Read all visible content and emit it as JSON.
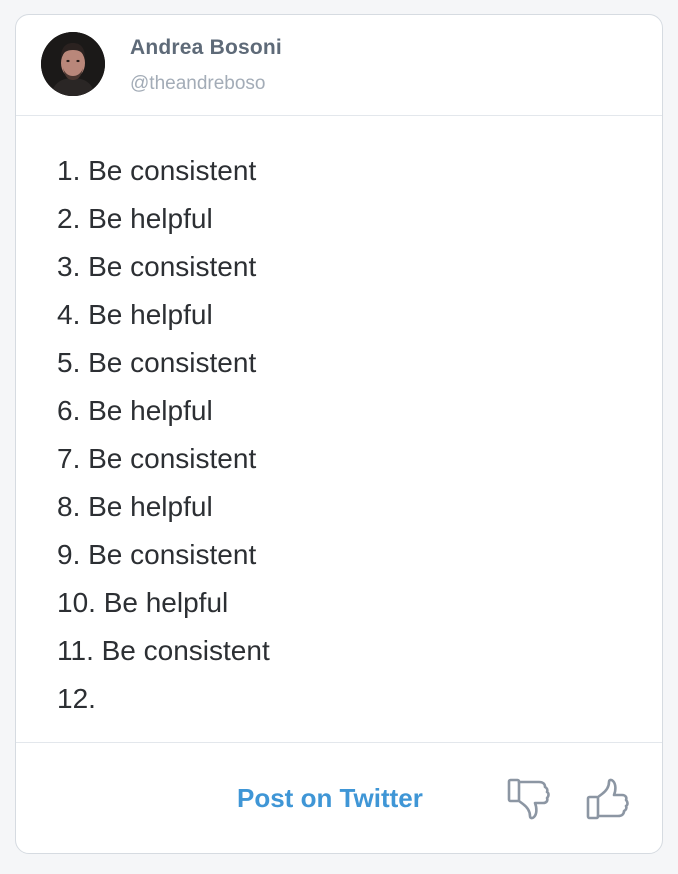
{
  "author": {
    "name": "Andrea Bosoni",
    "handle": "@theandreboso"
  },
  "post": {
    "lines": [
      "1. Be consistent",
      "2. Be helpful",
      "3. Be consistent",
      "4. Be helpful",
      "5. Be consistent",
      "6. Be helpful",
      "7. Be consistent",
      "8. Be helpful",
      "9. Be consistent",
      "10. Be helpful",
      "11. Be consistent",
      "12."
    ]
  },
  "footer": {
    "post_label": "Post on Twitter",
    "thumbs_down_icon": "thumbs-down-icon",
    "thumbs_up_icon": "thumbs-up-icon"
  },
  "colors": {
    "link": "#3f96d6",
    "name": "#5e6a78",
    "handle": "#a3acb7",
    "text": "#2c2f33",
    "icon": "#8c96a3"
  }
}
